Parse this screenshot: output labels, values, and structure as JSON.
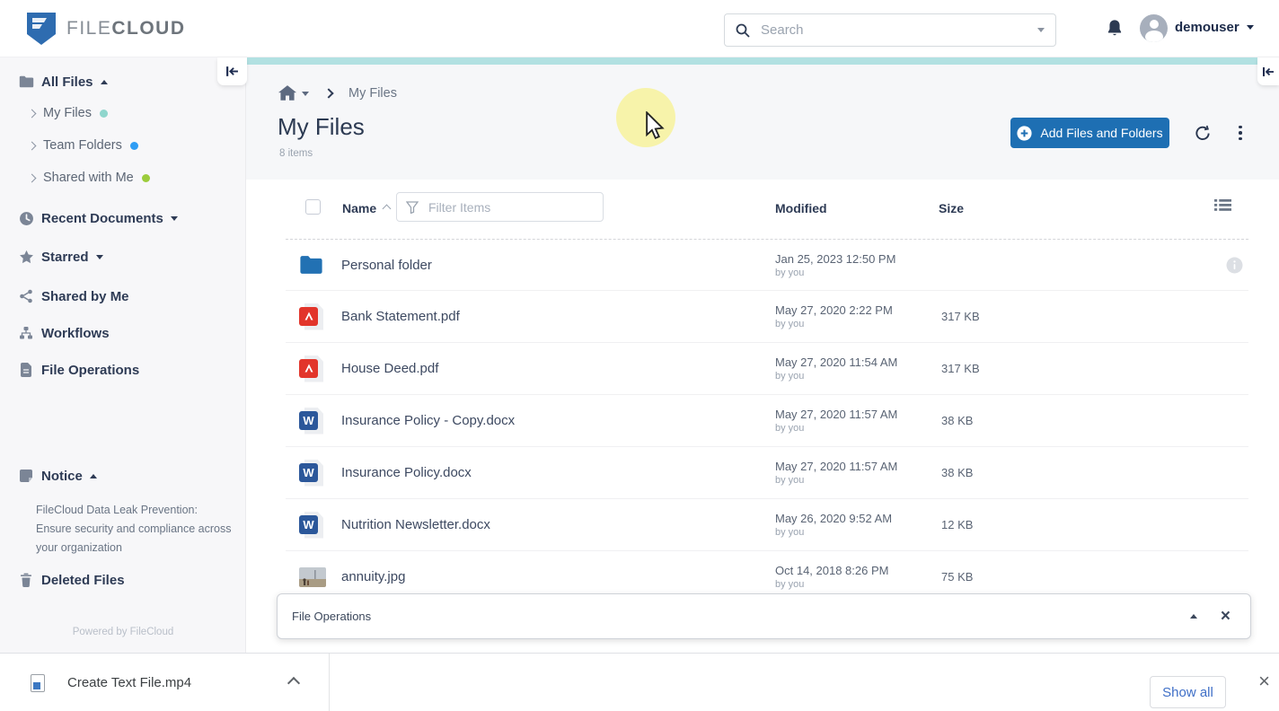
{
  "header": {
    "logo_file": "FILE",
    "logo_cloud": "CLOUD",
    "search": {
      "placeholder": "Search"
    },
    "user": {
      "name": "demouser"
    }
  },
  "sidebar": {
    "items": [
      {
        "label": "All Files",
        "icon": "folder-icon",
        "caret": "up"
      },
      {
        "label": "My Files",
        "icon": "chevron-right-icon",
        "dot_color": "#8fd6cd"
      },
      {
        "label": "Team Folders",
        "icon": "chevron-right-icon",
        "dot_color": "#2f9df4"
      },
      {
        "label": "Shared with Me",
        "icon": "chevron-right-icon",
        "dot_color": "#9ccc3c"
      },
      {
        "label": "Recent Documents",
        "icon": "clock-icon",
        "caret": "down"
      },
      {
        "label": "Starred",
        "icon": "star-icon",
        "caret": "down"
      },
      {
        "label": "Shared by Me",
        "icon": "share-icon"
      },
      {
        "label": "Workflows",
        "icon": "workflow-icon"
      },
      {
        "label": "File Operations",
        "icon": "document-icon"
      }
    ],
    "notice": {
      "title": "Notice",
      "icon": "note-icon",
      "text": "FileCloud Data Leak Prevention: Ensure security and compliance across your organization"
    },
    "deleted_files": {
      "label": "Deleted Files",
      "icon": "trash-icon"
    },
    "powered_by": "Powered by FileCloud"
  },
  "main": {
    "breadcrumb": {
      "current": "My Files"
    },
    "title": "My Files",
    "item_count": "8 items",
    "add_button_label": "Add Files and Folders",
    "table": {
      "columns": {
        "name": "Name",
        "modified": "Modified",
        "size": "Size"
      },
      "sort": "name-ascending",
      "filter_placeholder": "Filter Items",
      "rows": [
        {
          "name": "Personal folder",
          "icon": "folder-icon",
          "modified": "Jan 25, 2023 12:50 PM",
          "by": "by you",
          "size": ""
        },
        {
          "name": "Bank Statement.pdf",
          "icon": "pdf-file-icon",
          "modified": "May 27, 2020 2:22 PM",
          "by": "by you",
          "size": "317 KB"
        },
        {
          "name": "House Deed.pdf",
          "icon": "pdf-file-icon",
          "modified": "May 27, 2020 11:54 AM",
          "by": "by you",
          "size": "317 KB"
        },
        {
          "name": "Insurance Policy - Copy.docx",
          "icon": "word-file-icon",
          "modified": "May 27, 2020 11:57 AM",
          "by": "by you",
          "size": "38 KB"
        },
        {
          "name": "Insurance Policy.docx",
          "icon": "word-file-icon",
          "modified": "May 27, 2020 11:57 AM",
          "by": "by you",
          "size": "38 KB"
        },
        {
          "name": "Nutrition Newsletter.docx",
          "icon": "word-file-icon",
          "modified": "May 26, 2020 9:52 AM",
          "by": "by you",
          "size": "12 KB"
        },
        {
          "name": "annuity.jpg",
          "icon": "image-thumbnail",
          "modified": "Oct 14, 2018 8:26 PM",
          "by": "by you",
          "size": "75 KB"
        }
      ]
    }
  },
  "file_operations_panel": {
    "title": "File Operations"
  },
  "download_bar": {
    "file_name": "Create Text File.mp4",
    "show_all_label": "Show all"
  },
  "colors": {
    "accent_blue": "#1e6fb3",
    "teal_strip": "#b2e1e2",
    "pdf_red": "#e2352b",
    "word_blue": "#2b579a",
    "folder_blue": "#2271b3",
    "my_files_dot": "#8fd6cd",
    "team_folders_dot": "#2f9df4",
    "shared_with_me_dot": "#9ccc3c"
  }
}
